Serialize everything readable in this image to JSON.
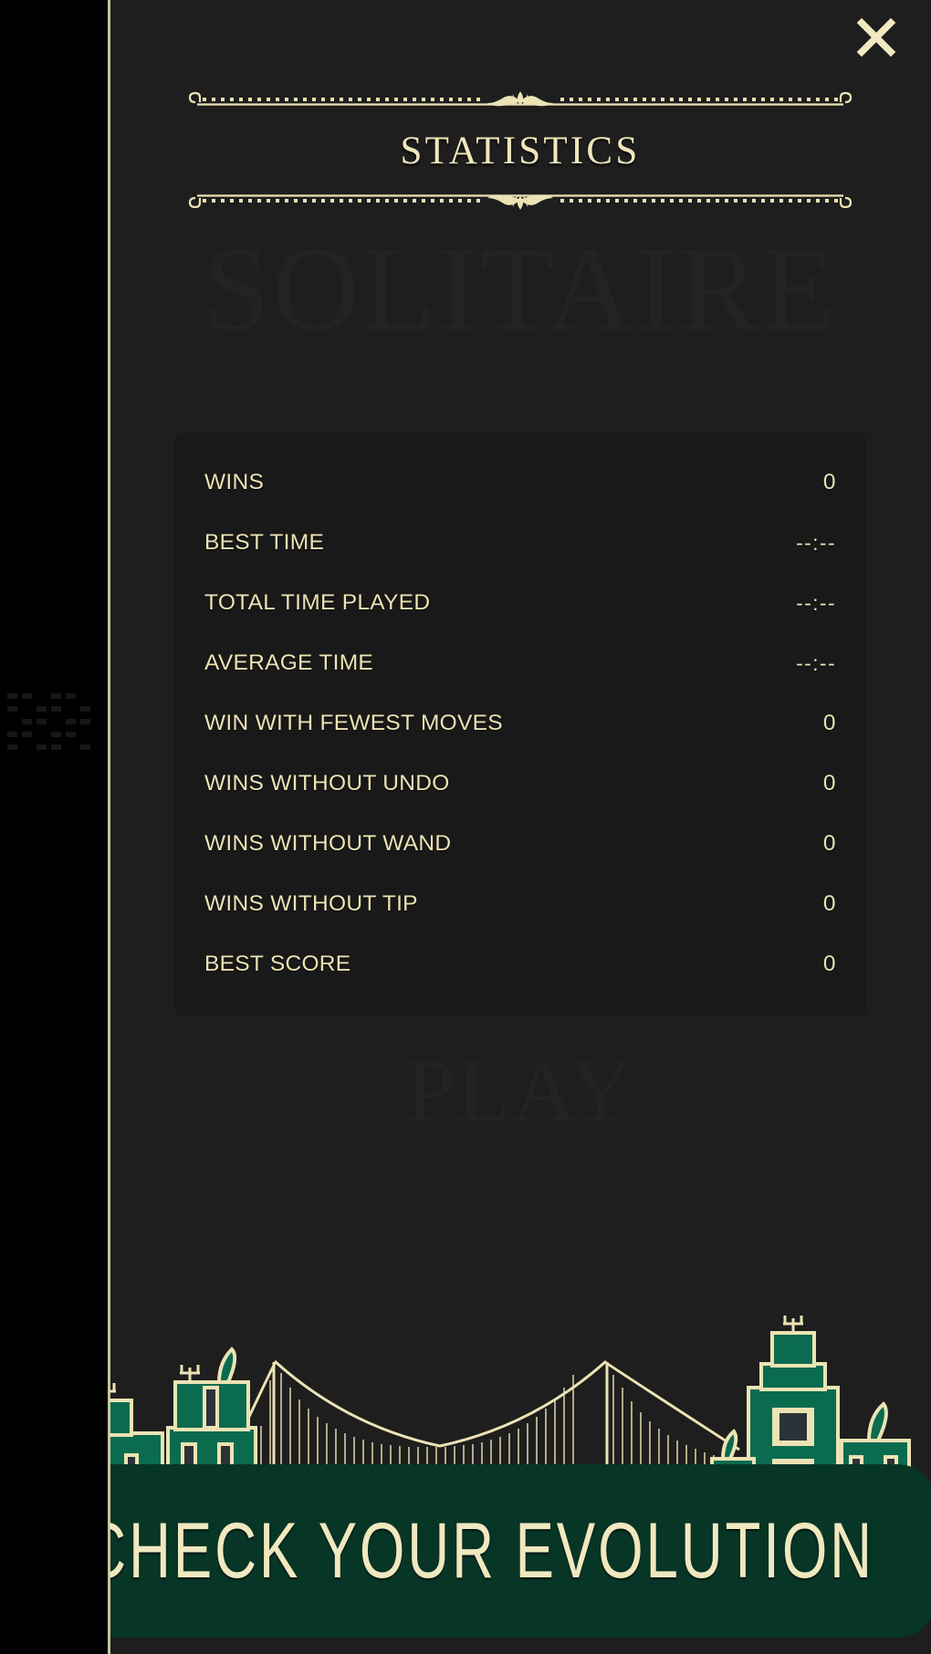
{
  "window": {
    "background_color": "#1e1e1e",
    "accent_cream": "#ece3b4",
    "accent_green": "#0b6b4f",
    "banner_green": "#073526"
  },
  "header": {
    "title": "STATISTICS",
    "close_label": "✕",
    "close_icon": "close-icon"
  },
  "background": {
    "ghost_title": "SOLITAIRE",
    "ghost_play": "PLAY"
  },
  "stats": {
    "rows": [
      {
        "label": "WINS",
        "value": "0"
      },
      {
        "label": "BEST TIME",
        "value": "--:--"
      },
      {
        "label": "TOTAL TIME PLAYED",
        "value": "--:--"
      },
      {
        "label": "AVERAGE TIME",
        "value": "--:--"
      },
      {
        "label": "WIN WITH FEWEST MOVES",
        "value": "0"
      },
      {
        "label": "WINS WITHOUT UNDO",
        "value": "0"
      },
      {
        "label": "WINS WITHOUT WAND",
        "value": "0"
      },
      {
        "label": "WINS WITHOUT TIP",
        "value": "0"
      },
      {
        "label": "BEST SCORE",
        "value": "0"
      }
    ]
  },
  "banner": {
    "text": "CHECK YOUR EVOLUTION"
  }
}
